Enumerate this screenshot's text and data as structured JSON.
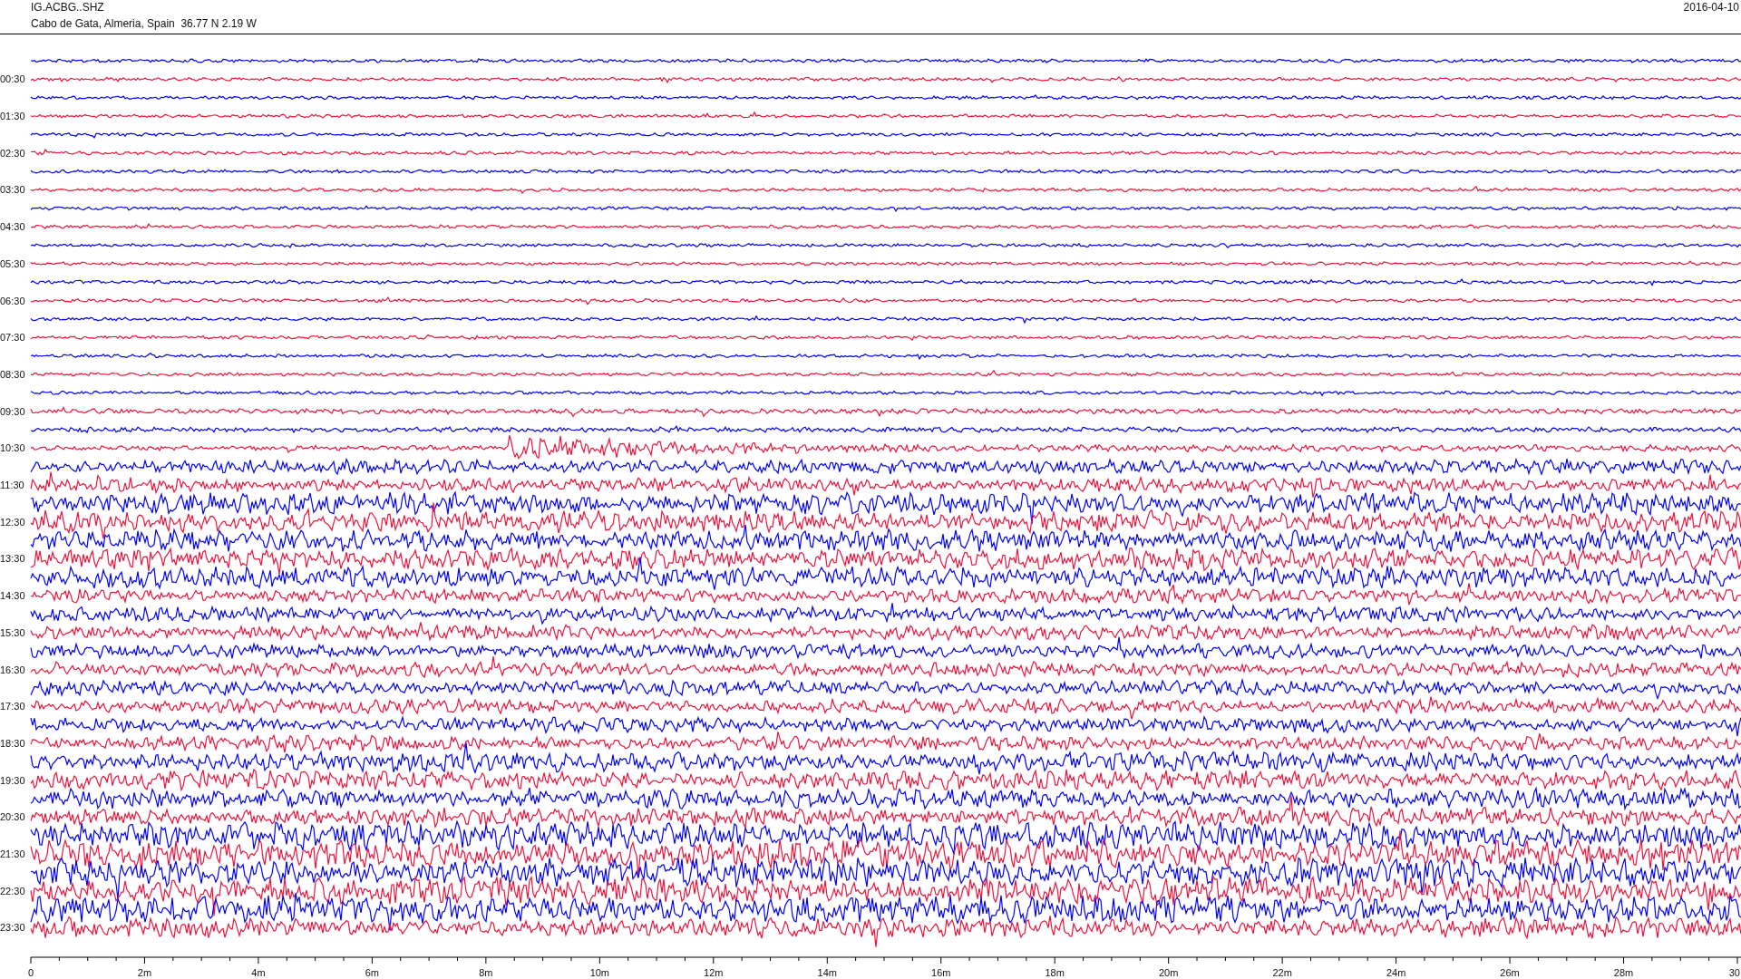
{
  "header": {
    "station": "IG.ACBG..SHZ",
    "location": "Cabo de Gata, Almeria, Spain  36.77 N 2.19 W",
    "date": "2016-04-10"
  },
  "traces": [
    {
      "color": "#0000ff"
    },
    {
      "color": "#f0143c",
      "label": "00:30"
    },
    {
      "color": "#0000ff"
    },
    {
      "color": "#f0143c",
      "label": "01:30"
    },
    {
      "color": "#0000ff"
    },
    {
      "color": "#f0143c",
      "label": "02:30"
    },
    {
      "color": "#0000ff"
    },
    {
      "color": "#f0143c",
      "label": "03:30"
    },
    {
      "color": "#0000ff"
    },
    {
      "color": "#f0143c",
      "label": "04:30"
    },
    {
      "color": "#0000ff"
    },
    {
      "color": "#f0143c",
      "label": "05:30"
    },
    {
      "color": "#0000ff"
    },
    {
      "color": "#f0143c",
      "label": "06:30"
    },
    {
      "color": "#0000ff"
    },
    {
      "color": "#f0143c",
      "label": "07:30"
    },
    {
      "color": "#0000ff"
    },
    {
      "color": "#f0143c",
      "label": "08:30"
    },
    {
      "color": "#0000ff"
    },
    {
      "color": "#f0143c",
      "label": "09:30"
    },
    {
      "color": "#0000ff"
    },
    {
      "color": "#f0143c",
      "label": "10:30"
    },
    {
      "color": "#0000ff"
    },
    {
      "color": "#f0143c",
      "label": "11:30"
    },
    {
      "color": "#0000ff"
    },
    {
      "color": "#f0143c",
      "label": "12:30"
    },
    {
      "color": "#0000ff"
    },
    {
      "color": "#f0143c",
      "label": "13:30"
    },
    {
      "color": "#0000ff"
    },
    {
      "color": "#f0143c",
      "label": "14:30"
    },
    {
      "color": "#0000ff"
    },
    {
      "color": "#f0143c",
      "label": "15:30"
    },
    {
      "color": "#0000ff"
    },
    {
      "color": "#f0143c",
      "label": "16:30"
    },
    {
      "color": "#0000ff"
    },
    {
      "color": "#f0143c",
      "label": "17:30"
    },
    {
      "color": "#0000ff"
    },
    {
      "color": "#f0143c",
      "label": "18:30"
    },
    {
      "color": "#0000ff"
    },
    {
      "color": "#f0143c",
      "label": "19:30"
    },
    {
      "color": "#0000ff"
    },
    {
      "color": "#f0143c",
      "label": "20:30"
    },
    {
      "color": "#0000ff"
    },
    {
      "color": "#f0143c",
      "label": "21:30"
    },
    {
      "color": "#0000ff"
    },
    {
      "color": "#f0143c",
      "label": "22:30"
    },
    {
      "color": "#0000ff"
    },
    {
      "color": "#f0143c",
      "label": "23:30"
    }
  ],
  "time_axis": {
    "labels": [
      "0",
      "2m",
      "4m",
      "6m",
      "8m",
      "10m",
      "12m",
      "14m",
      "16m",
      "18m",
      "20m",
      "22m",
      "24m",
      "26m",
      "28m",
      "30"
    ]
  }
}
